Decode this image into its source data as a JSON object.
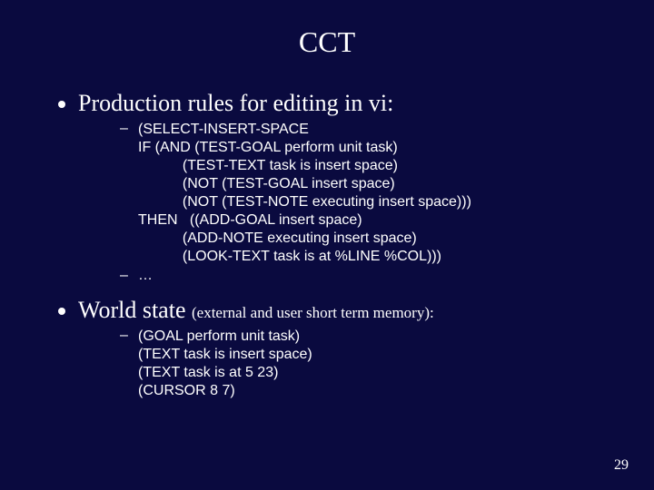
{
  "title": "CCT",
  "bullets": {
    "b1": "Production rules for editing in vi:",
    "b1_sub1": "(SELECT-INSERT-SPACE\nIF (AND (TEST-GOAL perform unit task)\n           (TEST-TEXT task is insert space)\n           (NOT (TEST-GOAL insert space)\n           (NOT (TEST-NOTE executing insert space)))\nTHEN   ((ADD-GOAL insert space)\n           (ADD-NOTE executing insert space)\n           (LOOK-TEXT task is at %LINE %COL)))",
    "b1_sub2": "…",
    "b2_main": "World state ",
    "b2_paren": "(external and user short term memory):",
    "b2_sub1": "(GOAL perform unit task)\n(TEXT task is insert space)\n(TEXT task is at 5 23)\n(CURSOR 8 7)"
  },
  "page_number": "29"
}
